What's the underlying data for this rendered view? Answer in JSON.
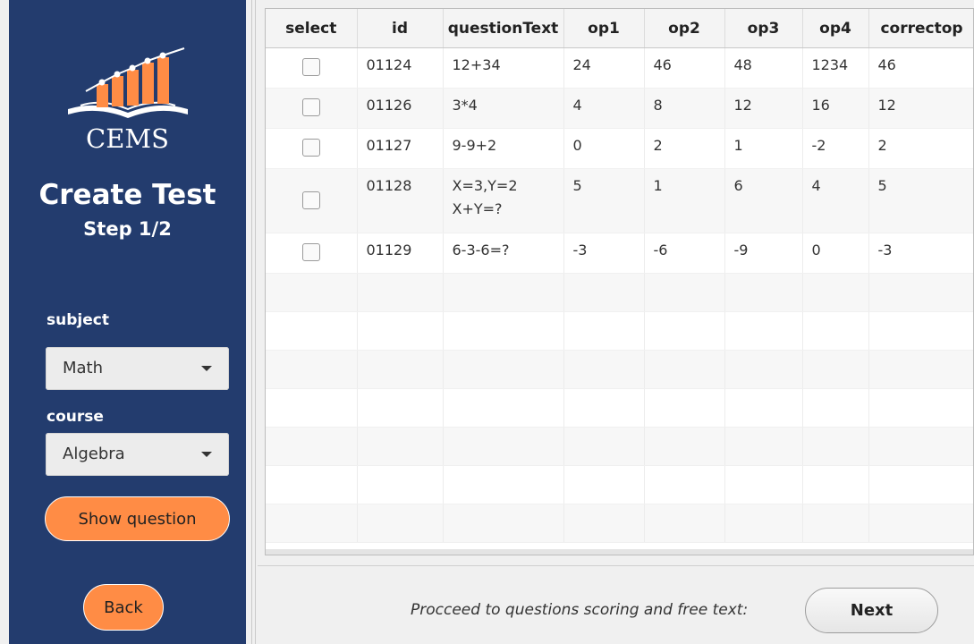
{
  "sidebar": {
    "brand": "CEMS",
    "title": "Create Test",
    "step": "Step 1/2",
    "subject_label": "subject",
    "subject_value": "Math",
    "course_label": "course",
    "course_value": "Algebra",
    "show_button": "Show question",
    "back_button": "Back"
  },
  "table": {
    "columns": [
      "select",
      "id",
      "questionText",
      "op1",
      "op2",
      "op3",
      "op4",
      "correctop"
    ],
    "rows": [
      {
        "id": "01124",
        "text": [
          "12+34"
        ],
        "op1": "24",
        "op2": "46",
        "op3": "48",
        "op4": "1234",
        "correct": "46"
      },
      {
        "id": "01126",
        "text": [
          "3*4"
        ],
        "op1": "4",
        "op2": "8",
        "op3": "12",
        "op4": "16",
        "correct": "12"
      },
      {
        "id": "01127",
        "text": [
          "9-9+2"
        ],
        "op1": "0",
        "op2": "2",
        "op3": "1",
        "op4": "-2",
        "correct": "2"
      },
      {
        "id": "01128",
        "text": [
          "X=3,Y=2",
          "X+Y=?"
        ],
        "op1": "5",
        "op2": "1",
        "op3": "6",
        "op4": "4",
        "correct": "5"
      },
      {
        "id": "01129",
        "text": [
          "6-3-6=?"
        ],
        "op1": "-3",
        "op2": "-6",
        "op3": "-9",
        "op4": "0",
        "correct": "-3"
      }
    ]
  },
  "footer": {
    "proceed_text": "Procceed to questions scoring and free text:",
    "next_button": "Next"
  },
  "colors": {
    "sidebar": "#233c6e",
    "accent": "#ff8c45"
  }
}
